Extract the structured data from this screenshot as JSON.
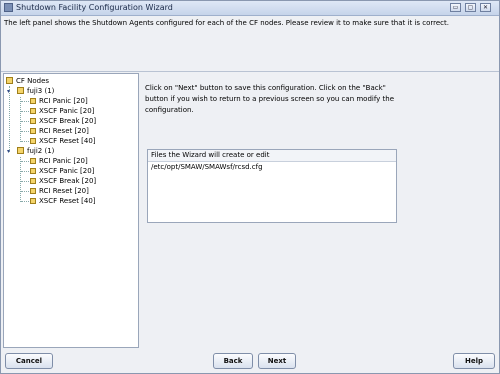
{
  "window": {
    "title": "Shutdown Facility Configuration Wizard",
    "controls": [
      "▭",
      "▢",
      "✕"
    ]
  },
  "description": "The left panel shows the Shutdown Agents configured for each of the CF nodes. Please review it to make sure that it is correct.",
  "tree": {
    "root": "CF Nodes",
    "nodes": [
      {
        "label": "fuji3 (1)",
        "agents": [
          "RCI Panic [20]",
          "XSCF Panic [20]",
          "XSCF Break [20]",
          "RCI Reset [20]",
          "XSCF Reset [40]"
        ]
      },
      {
        "label": "fuji2 (1)",
        "agents": [
          "RCI Panic [20]",
          "XSCF Panic [20]",
          "XSCF Break [20]",
          "RCI Reset [20]",
          "XSCF Reset [40]"
        ]
      }
    ]
  },
  "info_lines": [
    "Click on \"Next\" button to save this configuration. Click on the \"Back\"",
    "button if you wish to return to a previous screen so you can modify the",
    "configuration."
  ],
  "files": {
    "header": "Files the Wizard will create or edit",
    "items": [
      "/etc/opt/SMAW/SMAWsf/rcsd.cfg"
    ]
  },
  "buttons": {
    "cancel": "Cancel",
    "back": "Back",
    "next": "Next",
    "help": "Help"
  }
}
